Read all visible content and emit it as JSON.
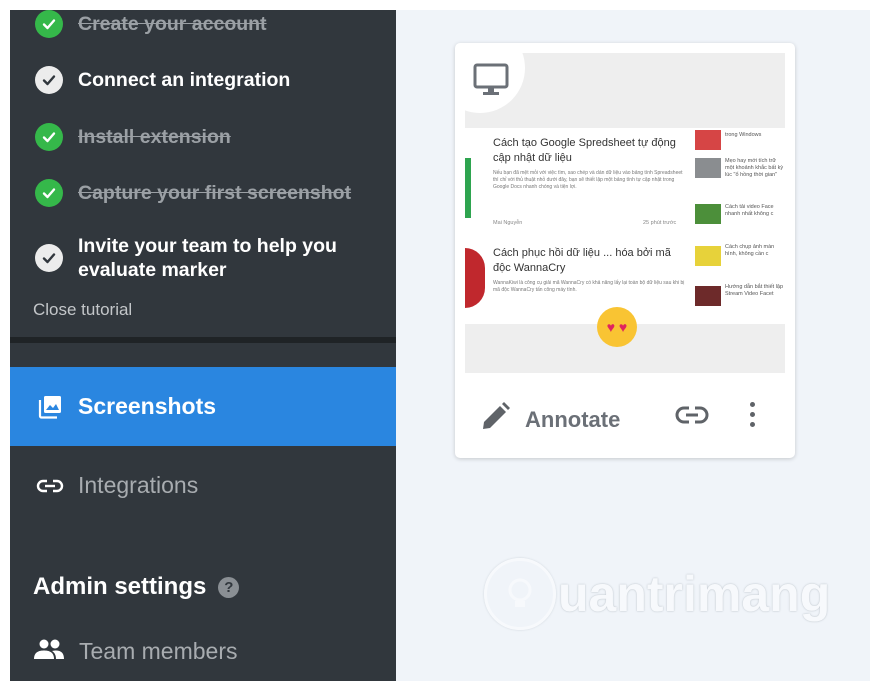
{
  "tutorial": {
    "tasks": [
      {
        "label": "Create your account",
        "done": true
      },
      {
        "label": "Connect an integration",
        "done": false
      },
      {
        "label": "Install extension",
        "done": true
      },
      {
        "label": "Capture your first screenshot",
        "done": true
      },
      {
        "label": "Invite your team to help you evaluate marker",
        "done": false
      }
    ],
    "close_label": "Close tutorial"
  },
  "nav": {
    "screenshots_label": "Screenshots",
    "integrations_label": "Integrations"
  },
  "admin": {
    "title": "Admin settings",
    "help_glyph": "?",
    "team_label": "Team members"
  },
  "card": {
    "annotate_label": "Annotate",
    "icons": [
      "monitor-icon",
      "pencil-icon",
      "link-icon",
      "more-vert-icon"
    ],
    "preview": {
      "article1_title": "Cách tạo Google Spredsheet tự động cập nhật dữ liệu",
      "article1_text": "Nếu bạn đã mệt mỏi với việc tìm, sao chép và dán dữ liệu vào bảng tính Spreadsheet thì chỉ với thủ thuật nhỏ dưới đây, bạn sẽ thiết lập một bảng tính tự cập nhật trong Google Docs nhanh chóng và tiện lợi.",
      "article1_author": "Mai Nguyễn",
      "article1_time": "25 phút trước",
      "article2_title": "Cách phục hồi dữ liệu ... hóa bởi mã độc WannaCry",
      "article2_text": "WannaKiwi là công cụ giải mã WannaCry có khả năng lấy lại toàn bộ dữ liệu sau khi bị mã độc WannaCry tấn công máy tính.",
      "side_items": [
        "trong Windows",
        "Mẹo hay mới tích trữ một khoảnh khắc bất kỳ lúc \"ổ hồng thời gian\"",
        "Cách tải video Face nhanh nhất không c",
        "Cách chụp ảnh màn hình, không cần c",
        "Hướng dẫn bắt thiết lập Stream Video Facet"
      ]
    }
  },
  "watermark": {
    "text": "uantrimang"
  },
  "colors": {
    "sidebar_bg": "#31373d",
    "active_nav": "#2a86e0",
    "check_done": "#35b84a",
    "main_bg": "#f0f4f9"
  }
}
